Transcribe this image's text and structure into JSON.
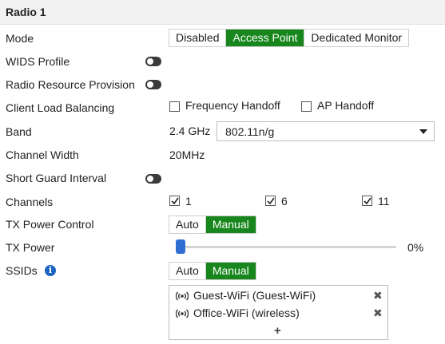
{
  "section": {
    "title": "Radio 1"
  },
  "rows": {
    "mode": {
      "label": "Mode",
      "options": [
        "Disabled",
        "Access Point",
        "Dedicated Monitor"
      ],
      "selected": "Access Point"
    },
    "wids": {
      "label": "WIDS Profile",
      "enabled": false
    },
    "rrp": {
      "label": "Radio Resource Provision",
      "enabled": false
    },
    "clb": {
      "label": "Client Load Balancing",
      "options": [
        {
          "label": "Frequency Handoff",
          "checked": false
        },
        {
          "label": "AP Handoff",
          "checked": false
        }
      ]
    },
    "band": {
      "label": "Band",
      "prefix": "2.4 GHz",
      "value": "802.11n/g"
    },
    "channel_width": {
      "label": "Channel Width",
      "value": "20MHz"
    },
    "sgi": {
      "label": "Short Guard Interval",
      "enabled": false
    },
    "channels": {
      "label": "Channels",
      "items": [
        {
          "label": "1",
          "checked": true
        },
        {
          "label": "6",
          "checked": true
        },
        {
          "label": "11",
          "checked": true
        }
      ]
    },
    "tx_power_control": {
      "label": "TX Power Control",
      "options": [
        "Auto",
        "Manual"
      ],
      "selected": "Manual"
    },
    "tx_power": {
      "label": "TX Power",
      "value_text": "0%",
      "value": 0
    },
    "ssids": {
      "label": "SSIDs",
      "options": [
        "Auto",
        "Manual"
      ],
      "selected": "Manual",
      "items": [
        "Guest-WiFi (Guest-WiFi)",
        "Office-WiFi (wireless)"
      ],
      "add_label": "+",
      "remove_label": "✖"
    }
  },
  "colors": {
    "active": "#17861c",
    "slider": "#2f6fd1",
    "info": "#1d64c2"
  }
}
